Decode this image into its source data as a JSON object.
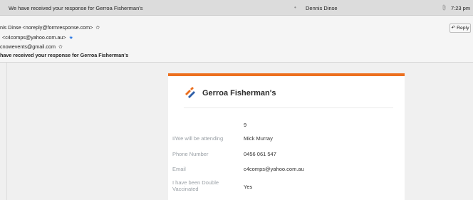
{
  "list_row": {
    "subject": "We have received your response for Gerroa Fisherman's",
    "dot": "•",
    "sender": "Dennis Dinse",
    "time": "7:23 pm",
    "time_icon": "clip-icon"
  },
  "header": {
    "from": "nis Dinse <noreply@formresponse.com>",
    "to": "<c4comps@yahoo.com.au>",
    "cc": "cnowevents@gmail.com",
    "subject": "have received your response for Gerroa Fisherman's",
    "reply_label": "Reply",
    "star_glyph": "✩",
    "star_blue_glyph": "★",
    "reply_glyph": "↶"
  },
  "card": {
    "brand": "Gerroa Fisherman's",
    "accent": "#ec6f1e",
    "fields": [
      {
        "label": "",
        "value": "9"
      },
      {
        "label": "I/We will be attending",
        "value": "Mick Murray"
      },
      {
        "label": "Phone Number",
        "value": "0456 061 547"
      },
      {
        "label": "Email",
        "value": "c4comps@yahoo.com.au"
      },
      {
        "label": "I have been Double Vaccinated",
        "value": "Yes"
      }
    ]
  }
}
